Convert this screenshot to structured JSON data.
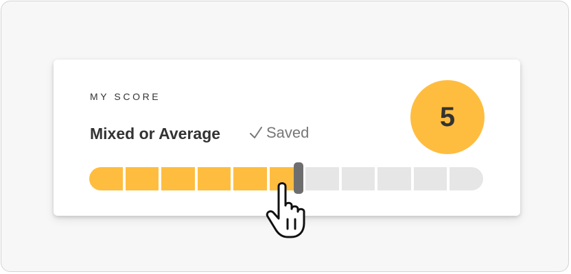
{
  "score_card": {
    "section_label": "MY SCORE",
    "verdict": "Mixed or Average",
    "saved_label": "Saved",
    "score": "5"
  },
  "slider": {
    "value": 5,
    "min": 0,
    "max": 11,
    "segment_count": 11
  },
  "icons": {
    "check": "check-icon",
    "pointer": "hand-pointer-cursor-icon"
  },
  "colors": {
    "accent": "#FFBD3F",
    "track_empty": "#E6E6E6",
    "thumb": "#6E6E6E",
    "text": "#333333",
    "muted": "#777777"
  }
}
